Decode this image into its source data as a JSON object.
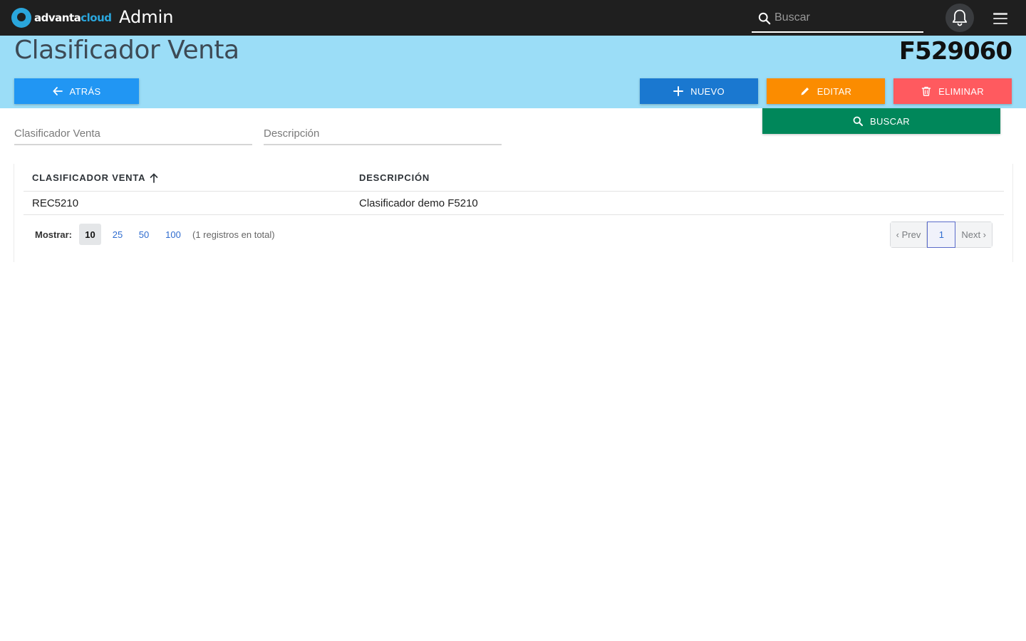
{
  "topbar": {
    "brand_part1": "advanta",
    "brand_part2": "cloud",
    "app_title": "Admin",
    "search_placeholder": "Buscar"
  },
  "header": {
    "title": "Clasificador Venta",
    "code": "F529060"
  },
  "actions": {
    "back": "ATRÁS",
    "new": "NUEVO",
    "edit": "EDITAR",
    "delete": "ELIMINAR",
    "search": "BUSCAR"
  },
  "filters": {
    "clasificador_placeholder": "Clasificador Venta",
    "descripcion_placeholder": "Descripción"
  },
  "table": {
    "columns": [
      "CLASIFICADOR VENTA",
      "DESCRIPCIÓN"
    ],
    "rows": [
      [
        "REC5210",
        "Clasificador demo F5210"
      ]
    ]
  },
  "pagination": {
    "show_label": "Mostrar:",
    "page_sizes": [
      "10",
      "25",
      "50",
      "100"
    ],
    "selected_page_size": "10",
    "total_text": "(1 registros en total)",
    "prev": "‹ Prev",
    "current_page": "1",
    "next": "Next ›"
  },
  "colors": {
    "topbar": "#1f1f1f",
    "band": "#9bddf7",
    "back": "#2196f3",
    "new": "#1a78d0",
    "edit": "#fb8c00",
    "delete": "#ff5a5f",
    "search": "#00875a"
  }
}
